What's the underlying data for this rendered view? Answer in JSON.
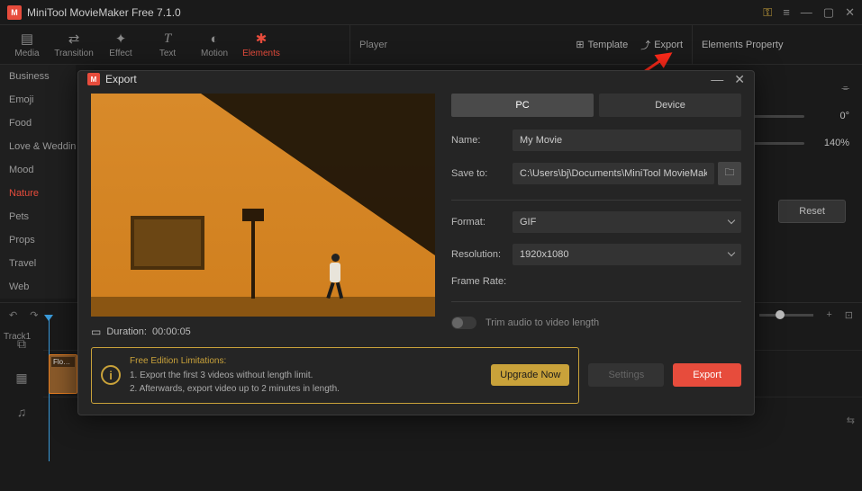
{
  "app": {
    "title": "MiniTool MovieMaker Free 7.1.0"
  },
  "toolbar": {
    "items": [
      {
        "label": "Media",
        "icon": "▤"
      },
      {
        "label": "Transition",
        "icon": "⇄"
      },
      {
        "label": "Effect",
        "icon": "✦"
      },
      {
        "label": "Text",
        "icon": "T"
      },
      {
        "label": "Motion",
        "icon": "◐"
      },
      {
        "label": "Elements",
        "icon": "✱",
        "active": true
      }
    ],
    "player_label": "Player",
    "template_label": "Template",
    "export_label": "Export",
    "properties_label": "Elements Property"
  },
  "categories": [
    "Business",
    "Emoji",
    "Food",
    "Love & Wedding",
    "Mood",
    "Nature",
    "Pets",
    "Props",
    "Travel",
    "Web"
  ],
  "categories_active_index": 5,
  "properties": {
    "rotation": "0°",
    "scale": "140%",
    "reset": "Reset"
  },
  "timeline": {
    "track1_label": "Track1",
    "clip_label": "Flo…"
  },
  "export_modal": {
    "title": "Export",
    "tabs": {
      "pc": "PC",
      "device": "Device"
    },
    "fields": {
      "name_label": "Name:",
      "name_value": "My Movie",
      "saveto_label": "Save to:",
      "saveto_value": "C:\\Users\\bj\\Documents\\MiniTool MovieMaker\\outp",
      "format_label": "Format:",
      "format_value": "GIF",
      "resolution_label": "Resolution:",
      "resolution_value": "1920x1080",
      "framerate_label": "Frame Rate:",
      "trim_label": "Trim audio to video length"
    },
    "duration_label": "Duration:",
    "duration_value": "00:00:05",
    "limitation": {
      "title": "Free Edition Limitations:",
      "line1": "1. Export the first 3 videos without length limit.",
      "line2": "2. Afterwards, export video up to 2 minutes in length.",
      "upgrade": "Upgrade Now"
    },
    "buttons": {
      "settings": "Settings",
      "export": "Export"
    }
  }
}
